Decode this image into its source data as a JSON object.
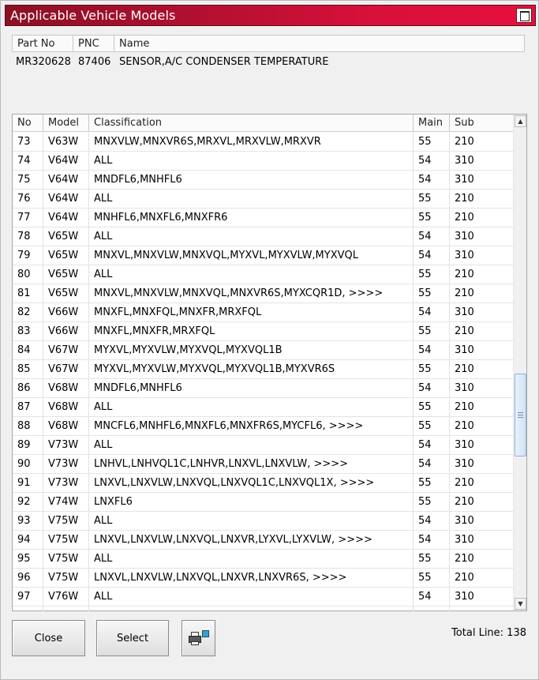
{
  "window": {
    "title": "Applicable Vehicle Models"
  },
  "part": {
    "headers": [
      "Part No",
      "PNC",
      "Name"
    ],
    "part_no": "MR320628",
    "pnc": "87406",
    "name": "SENSOR,A/C CONDENSER TEMPERATURE"
  },
  "table": {
    "headers": [
      "No",
      "Model",
      "Classification",
      "Main",
      "Sub"
    ],
    "rows": [
      {
        "no": "73",
        "model": "V63W",
        "classification": "MNXVLW,MNXVR6S,MRXVL,MRXVLW,MRXVR",
        "main": "55",
        "sub": "210"
      },
      {
        "no": "74",
        "model": "V64W",
        "classification": "ALL",
        "main": "54",
        "sub": "310"
      },
      {
        "no": "75",
        "model": "V64W",
        "classification": "MNDFL6,MNHFL6",
        "main": "54",
        "sub": "310"
      },
      {
        "no": "76",
        "model": "V64W",
        "classification": "ALL",
        "main": "55",
        "sub": "210"
      },
      {
        "no": "77",
        "model": "V64W",
        "classification": "MNHFL6,MNXFL6,MNXFR6",
        "main": "55",
        "sub": "210"
      },
      {
        "no": "78",
        "model": "V65W",
        "classification": "ALL",
        "main": "54",
        "sub": "310"
      },
      {
        "no": "79",
        "model": "V65W",
        "classification": "MNXVL,MNXVLW,MNXVQL,MYXVL,MYXVLW,MYXVQL",
        "main": "54",
        "sub": "310"
      },
      {
        "no": "80",
        "model": "V65W",
        "classification": "ALL",
        "main": "55",
        "sub": "210"
      },
      {
        "no": "81",
        "model": "V65W",
        "classification": "MNXVL,MNXVLW,MNXVQL,MNXVR6S,MYXCQR1D,   >>>>",
        "main": "55",
        "sub": "210"
      },
      {
        "no": "82",
        "model": "V66W",
        "classification": "MNXFL,MNXFQL,MNXFR,MRXFQL",
        "main": "54",
        "sub": "310"
      },
      {
        "no": "83",
        "model": "V66W",
        "classification": "MNXFL,MNXFR,MRXFQL",
        "main": "55",
        "sub": "210"
      },
      {
        "no": "84",
        "model": "V67W",
        "classification": "MYXVL,MYXVLW,MYXVQL,MYXVQL1B",
        "main": "54",
        "sub": "310"
      },
      {
        "no": "85",
        "model": "V67W",
        "classification": "MYXVL,MYXVLW,MYXVQL,MYXVQL1B,MYXVR6S",
        "main": "55",
        "sub": "210"
      },
      {
        "no": "86",
        "model": "V68W",
        "classification": "MNDFL6,MNHFL6",
        "main": "54",
        "sub": "310"
      },
      {
        "no": "87",
        "model": "V68W",
        "classification": "ALL",
        "main": "55",
        "sub": "210"
      },
      {
        "no": "88",
        "model": "V68W",
        "classification": "MNCFL6,MNHFL6,MNXFL6,MNXFR6S,MYCFL6,   >>>>",
        "main": "55",
        "sub": "210"
      },
      {
        "no": "89",
        "model": "V73W",
        "classification": "ALL",
        "main": "54",
        "sub": "310"
      },
      {
        "no": "90",
        "model": "V73W",
        "classification": "LNHVL,LNHVQL1C,LNHVR,LNXVL,LNXVLW,   >>>>",
        "main": "54",
        "sub": "310"
      },
      {
        "no": "91",
        "model": "V73W",
        "classification": "LNXVL,LNXVLW,LNXVQL,LNXVQL1C,LNXVQL1X,   >>>>",
        "main": "55",
        "sub": "210"
      },
      {
        "no": "92",
        "model": "V74W",
        "classification": "LNXFL6",
        "main": "55",
        "sub": "210"
      },
      {
        "no": "93",
        "model": "V75W",
        "classification": "ALL",
        "main": "54",
        "sub": "310"
      },
      {
        "no": "94",
        "model": "V75W",
        "classification": "LNXVL,LNXVLW,LNXVQL,LNXVR,LYXVL,LYXVLW,   >>>>",
        "main": "54",
        "sub": "310"
      },
      {
        "no": "95",
        "model": "V75W",
        "classification": "ALL",
        "main": "55",
        "sub": "210"
      },
      {
        "no": "96",
        "model": "V75W",
        "classification": "LNXVL,LNXVLW,LNXVQL,LNXVR,LNXVR6S,   >>>>",
        "main": "55",
        "sub": "210"
      },
      {
        "no": "97",
        "model": "V76W",
        "classification": "ALL",
        "main": "54",
        "sub": "310"
      }
    ]
  },
  "buttons": {
    "close": "Close",
    "select": "Select",
    "print_icon": "printer-icon"
  },
  "footer": {
    "total_label": "Total Line: 138"
  },
  "colors": {
    "title_start": "#8a1024",
    "title_end": "#e5103f"
  }
}
